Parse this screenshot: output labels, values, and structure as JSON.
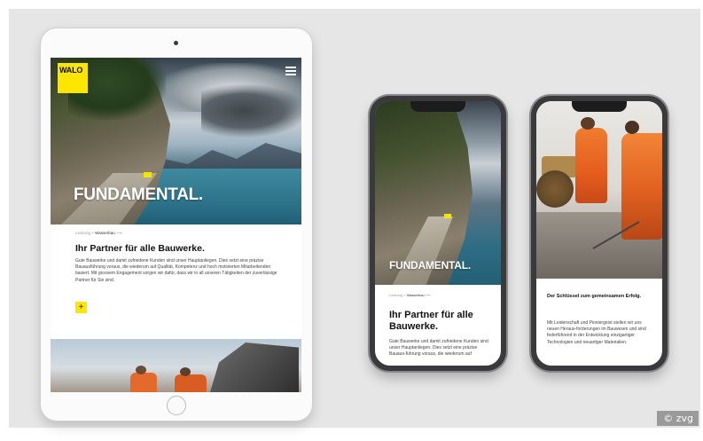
{
  "brand": {
    "logo_text": "WALO",
    "accent_color": "#ffe600"
  },
  "tablet": {
    "hero_title": "FUNDAMENTAL.",
    "breadcrumb_prev": "Leistung",
    "breadcrumb_sep": " > ",
    "breadcrumb_current": "Wasserbau",
    "breadcrumb_arrow": "⟶",
    "heading": "Ihr Partner für alle Bauwerke.",
    "body": "Gute Bauwerke und damit zufriedene Kunden sind unser Hauptanliegen. Dies setzt eine präzise Bauausführung voraus, die wiederum auf Qualität, Kompetenz und hoch motivierten Mitarbeitenden basiert. Mit grossem Engagement sorgen wir dafür, dass wir in all unseren Tätigkeiten der zuverlässige Partner für Sie sind.",
    "plus_label": "+"
  },
  "phone1": {
    "hero_title": "FUNDAMENTAL.",
    "breadcrumb_prev": "Leistung",
    "breadcrumb_sep": " > ",
    "breadcrumb_current": "Wasserbau",
    "breadcrumb_arrow": "⟶",
    "heading": "Ihr Partner für alle Bauwerke.",
    "body": "Gute Bauwerke und damit zufriedene Kunden sind unser Hauptanliegen. Dies setzt eine präzise Bauaus-führung voraus, die wiederum auf"
  },
  "phone2": {
    "heading": "Der Schlüssel zum gemeinsamen Erfolg.",
    "body": "Mit Leidenschaft und Pioniergeist stellen wir uns neuen Heraus-forderungen im Bauwesen und sind federführend in der Entwicklung einzigartiger Technologien und neuartiger Materialien."
  },
  "credit": "© zvg"
}
